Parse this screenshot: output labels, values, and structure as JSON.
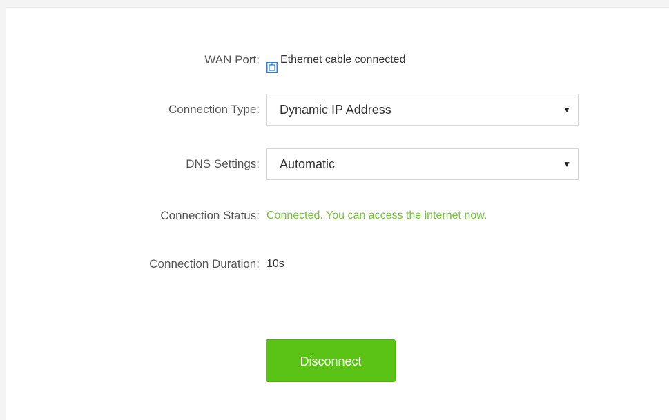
{
  "wan_port": {
    "label": "WAN Port:",
    "icon": "ethernet-port-icon",
    "value": "Ethernet cable connected"
  },
  "connection_type": {
    "label": "Connection Type:",
    "selected": "Dynamic IP Address"
  },
  "dns_settings": {
    "label": "DNS Settings:",
    "selected": "Automatic"
  },
  "connection_status": {
    "label": "Connection Status:",
    "value": "Connected. You can access the internet now.",
    "color": "#76c33a"
  },
  "connection_duration": {
    "label": "Connection Duration:",
    "value": "10s"
  },
  "actions": {
    "disconnect_label": "Disconnect",
    "button_color": "#5ac315"
  }
}
